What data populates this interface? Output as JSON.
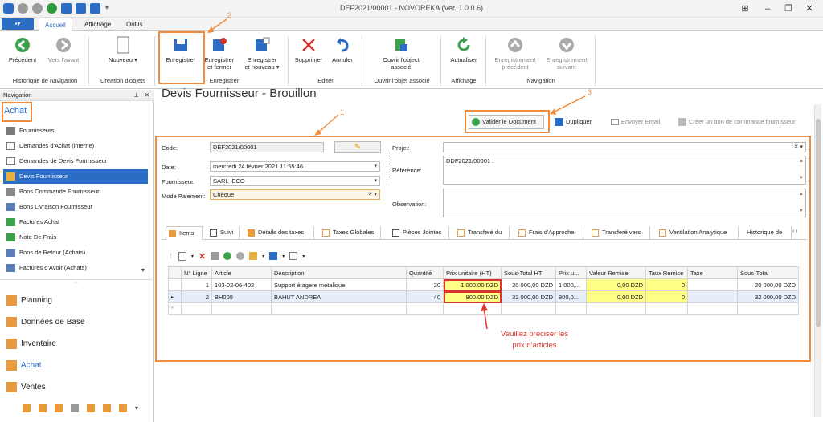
{
  "window": {
    "title": "DEF2021/00001 - NOVOREKA (Ver. 1.0.0.6)"
  },
  "ribbon_tabs": [
    "Accueil",
    "Affichage",
    "Outils"
  ],
  "ribbon": {
    "buttons": {
      "precedent": "Précédent",
      "vers_lavant": "Vers l'avant",
      "nouveau": "Nouveau",
      "enregistrer": "Enregistrer",
      "enregistrer_fermer_1": "Enregistrer",
      "enregistrer_fermer_2": "et fermer",
      "enregistrer_nouveau_1": "Enregistrer",
      "enregistrer_nouveau_2": "et nouveau",
      "supprimer": "Supprimer",
      "annuler": "Annuler",
      "ouvrir_objet_1": "Ouvrir l'object",
      "ouvrir_objet_2": "associé",
      "actualiser": "Actualiser",
      "enr_precedent_1": "Enregistrement",
      "enr_precedent_2": "précédent",
      "enr_suivant_1": "Enregistrement",
      "enr_suivant_2": "suivant"
    },
    "groups": {
      "historique": "Historique de navigation",
      "creation": "Création d'objets",
      "enregistrer": "Enregistrer",
      "editer": "Editer",
      "ouvrir": "Ouvrir l'objet associé",
      "affichage": "Affichage",
      "navigation": "Navigation"
    }
  },
  "nav": {
    "header": "Navigation",
    "section": "Achat",
    "items": [
      "Fournisseurs",
      "Demandes d'Achat (interne)",
      "Demandes de Devis Fournisseur",
      "Devis Fournisseur",
      "Bons Commande Fournisseur",
      "Bons Livraison Fournisseur",
      "Factures Achat",
      "Note De Frais",
      "Bons de Retour (Achats)",
      "Factures d'Avoir (Achats)"
    ],
    "groups": [
      "Planning",
      "Données de Base",
      "Inventaire",
      "Achat",
      "Ventes"
    ]
  },
  "page": {
    "title": "Devis Fournisseur - Brouillon"
  },
  "actions": {
    "valider": "Valider le Document",
    "dupliquer": "Dupliquer",
    "envoyer": "Envoyer Email",
    "creer_bon": "Créer un bon de commande fournisseur"
  },
  "form": {
    "code_label": "Code:",
    "code_value": "DEF2021/00001",
    "date_label": "Date:",
    "date_value": "mercredi 24 février 2021 11:55:46",
    "fournisseur_label": "Fournisseur:",
    "fournisseur_value": "SARL IECO",
    "mode_label": "Mode Paiement:",
    "mode_value": "Chèque",
    "projet_label": "Projet:",
    "reference_label": "Référence:",
    "reference_value": "DDF2021/00001 :",
    "observation_label": "Observation:"
  },
  "tabs": [
    "Items",
    "Suivi",
    "Détails des taxes",
    "Taxes Globales",
    "Pièces Jointes",
    "Transferé du",
    "Frais d'Approche",
    "Transferé vers",
    "Ventilation Analytique",
    "Historique de"
  ],
  "grid": {
    "columns": [
      "N° Ligne",
      "Article",
      "Description",
      "Quantité",
      "Prix unitaire (HT)",
      "Sous-Total HT",
      "Prix u...",
      "Valeur Remise",
      "Taux Remise",
      "Taxe",
      "Sous-Total"
    ],
    "rows": [
      {
        "ligne": "1",
        "article": "103-02-06-402",
        "description": "Support étagere métalique",
        "quantite": "20",
        "prix": "1 000,00 DZD",
        "sous_total_ht": "20 000,00 DZD",
        "prix_u": "1 000,...",
        "valeur_remise": "0,00 DZD",
        "taux_remise": "0",
        "taxe": "",
        "sous_total": "20 000,00 DZD"
      },
      {
        "ligne": "2",
        "article": "BH009",
        "description": "BAHUT ANDREA",
        "quantite": "40",
        "prix": "800,00 DZD",
        "sous_total_ht": "32 000,00 DZD",
        "prix_u": "800,0...",
        "valeur_remise": "0,00 DZD",
        "taux_remise": "0",
        "taxe": "",
        "sous_total": "32 000,00 DZD"
      }
    ]
  },
  "annotations": {
    "n1": "1",
    "n2": "2",
    "n3": "3",
    "note_1": "Veuillez preciser les",
    "note_2": "prix d'articles"
  },
  "colors": {
    "accent": "#2b6cc4",
    "highlight": "#f08c3c",
    "editable": "#ffff88",
    "note": "#d9342b"
  }
}
